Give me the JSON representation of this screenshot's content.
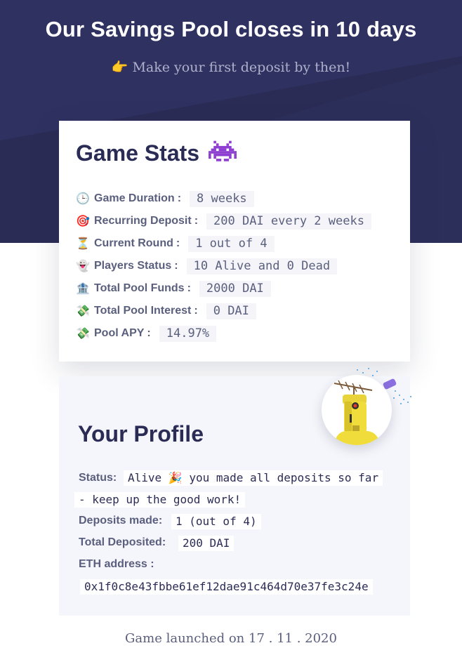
{
  "hero": {
    "title": "Our Savings Pool closes in 10 days",
    "subtitle": "Make your first deposit by then!",
    "subtitle_icon": "pointing-hand-icon"
  },
  "stats": {
    "title": "Game Stats",
    "title_icon": "space-invader-icon",
    "rows": [
      {
        "icon": "clock-icon",
        "glyph": "🕒",
        "label": "Game Duration",
        "value": "8 weeks"
      },
      {
        "icon": "target-icon",
        "glyph": "🎯",
        "label": "Recurring Deposit",
        "value": "200 DAI every 2 weeks"
      },
      {
        "icon": "hourglass-icon",
        "glyph": "⏳",
        "label": "Current Round",
        "value": "1 out of 4"
      },
      {
        "icon": "ghost-icon",
        "glyph": "👻",
        "label": "Players Status",
        "value": "10 Alive and 0 Dead"
      },
      {
        "icon": "bank-icon",
        "glyph": "🏦",
        "label": "Total Pool Funds",
        "value": "2000 DAI"
      },
      {
        "icon": "money-wings-icon",
        "glyph": "💸",
        "label": "Total Pool Interest",
        "value": "0 DAI"
      },
      {
        "icon": "money-wings-icon",
        "glyph": "💸",
        "label": "Pool APY",
        "value": "14.97%"
      }
    ]
  },
  "profile": {
    "title": "Your Profile",
    "avatar_icon": "robot-avatar-icon",
    "status_label": "Status:",
    "status_value_line1": "Alive 🎉 you made all deposits so far",
    "status_value_line2": "- keep up the good work!",
    "deposits_label": "Deposits made:",
    "deposits_value": "1 (out of 4)",
    "total_label": "Total Deposited:",
    "total_value": "200 DAI",
    "eth_label": "ETH address :",
    "eth_value": "0x1f0c8e43fbbe61ef12dae91c464d70e37fe3c24e"
  },
  "footer": {
    "text": "Game launched on 17 . 11 . 2020"
  },
  "colors": {
    "hero_bg": "#2b2c55",
    "title_text": "#2b2c55",
    "label_text": "#5a5f7d",
    "profile_bg": "#f5f6fb"
  }
}
